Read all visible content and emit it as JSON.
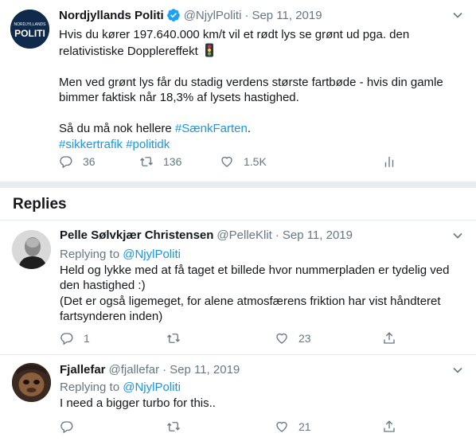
{
  "main_tweet": {
    "name": "Nordjyllands Politi",
    "handle": "@NjylPoliti",
    "date": "Sep 11, 2019",
    "avatar_text_top": "NORDJYLLANDS",
    "avatar_text_bottom": "POLITI",
    "line1": "Hvis du kører 197.640.000 km/t vil et rødt lys se grønt ud pga. den",
    "line2": "relativistiske Dopplereffekt",
    "line3": "Men ved grønt lys får du stadig verdens største fartbøde - hvis din gamle",
    "line4": "bimmer faktisk når 18,3% af lysets hastighed.",
    "line5_prefix": "Så du må nok hellere ",
    "hashtag1": "#SænkFarten",
    "line5_suffix": ".",
    "hashtag2": "#sikkertrafik",
    "hashtag3": "#politidk",
    "replies_count": "36",
    "retweets_count": "136",
    "likes_count": "1.5K"
  },
  "replies_heading": "Replies",
  "reply1": {
    "name": "Pelle Sølvkjær Christensen",
    "handle": "@PelleKlit",
    "date": "Sep 11, 2019",
    "replying_prefix": "Replying to ",
    "replying_handle": "@NjylPoliti",
    "line1": "Held og lykke med at få taget et billede hvor nummerpladen er tydelig ved",
    "line2": "den hastighed :)",
    "line3": "(Det er også ligemeget, for alene atmosfærens friktion har vist håndteret",
    "line4": "fartsynderen inden)",
    "replies_count": "1",
    "retweets_count": "",
    "likes_count": "23"
  },
  "reply2": {
    "name": "Fjallefar",
    "handle": "@fjallefar",
    "date": "Sep 11, 2019",
    "replying_prefix": "Replying to ",
    "replying_handle": "@NjylPoliti",
    "line1": "I need a bigger turbo for this..",
    "replies_count": "",
    "retweets_count": "",
    "likes_count": "21"
  },
  "colors": {
    "link": "#1b95e0",
    "muted": "#657786",
    "text": "#14171a",
    "divider": "#e6ecf0",
    "police_navy": "#0f2a4a"
  },
  "icons": [
    "verified-badge-icon",
    "caret-down-icon",
    "reply-icon",
    "retweet-icon",
    "like-icon",
    "share-icon",
    "analytics-icon",
    "traffic-light-icon"
  ]
}
